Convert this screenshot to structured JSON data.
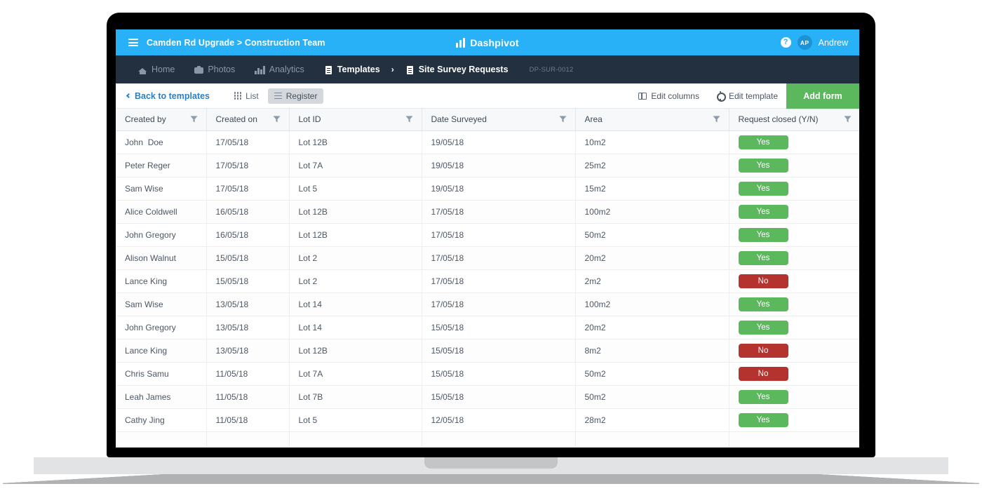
{
  "topbar": {
    "menu_icon": "hamburger-icon",
    "breadcrumb": "Camden Rd Upgrade > Construction Team",
    "brand": "Dashpivot",
    "brand_icon": "bar-chart-icon",
    "help_icon": "help-circle-icon",
    "help_glyph": "?",
    "avatar_initials": "AP",
    "user_name": "Andrew",
    "bg_color": "#29b1f7"
  },
  "nav": {
    "items": [
      {
        "label": "Home",
        "icon": "home-icon",
        "active": false
      },
      {
        "label": "Photos",
        "icon": "camera-icon",
        "active": false
      },
      {
        "label": "Analytics",
        "icon": "analytics-icon",
        "active": false
      },
      {
        "label": "Templates",
        "icon": "document-icon",
        "active": true
      },
      {
        "label": "Site Survey Requests",
        "icon": "document-icon",
        "active": true
      }
    ],
    "separator": "›",
    "code": "DP-SUR-0012",
    "bg_color": "#22303f"
  },
  "toolbar": {
    "back_label": "Back to templates",
    "back_icon": "chevron-left-icon",
    "view_tabs": [
      {
        "label": "List",
        "icon": "grid-icon",
        "active": false
      },
      {
        "label": "Register",
        "icon": "lines-icon",
        "active": true
      }
    ],
    "edit_columns_label": "Edit columns",
    "edit_columns_icon": "columns-icon",
    "edit_template_label": "Edit template",
    "edit_template_icon": "gear-icon",
    "add_form_label": "Add form",
    "add_form_color": "#5cb85c"
  },
  "table": {
    "columns": [
      {
        "label": "Created by",
        "filter_icon": "filter-icon"
      },
      {
        "label": "Created on",
        "filter_icon": "filter-icon"
      },
      {
        "label": "Lot ID",
        "filter_icon": "filter-icon"
      },
      {
        "label": "Date Surveyed",
        "filter_icon": "filter-icon"
      },
      {
        "label": "Area",
        "filter_icon": "filter-icon"
      },
      {
        "label": "Request closed (Y/N)",
        "filter_icon": "filter-icon"
      }
    ],
    "rows": [
      {
        "created_by": "John  Doe",
        "created_on": "17/05/18",
        "lot_id": "Lot 12B",
        "date_surveyed": "19/05/18",
        "area": "10m2",
        "closed": "Yes"
      },
      {
        "created_by": "Peter Reger",
        "created_on": "17/05/18",
        "lot_id": "Lot 7A",
        "date_surveyed": "19/05/18",
        "area": "25m2",
        "closed": "Yes"
      },
      {
        "created_by": "Sam Wise",
        "created_on": "17/05/18",
        "lot_id": "Lot 5",
        "date_surveyed": "19/05/18",
        "area": "15m2",
        "closed": "Yes"
      },
      {
        "created_by": "Alice Coldwell",
        "created_on": "16/05/18",
        "lot_id": "Lot 12B",
        "date_surveyed": "17/05/18",
        "area": "100m2",
        "closed": "Yes"
      },
      {
        "created_by": "John Gregory",
        "created_on": "16/05/18",
        "lot_id": "Lot 12B",
        "date_surveyed": "17/05/18",
        "area": "50m2",
        "closed": "Yes"
      },
      {
        "created_by": "Alison Walnut",
        "created_on": "15/05/18",
        "lot_id": "Lot 2",
        "date_surveyed": "17/05/18",
        "area": "20m2",
        "closed": "Yes"
      },
      {
        "created_by": "Lance King",
        "created_on": "15/05/18",
        "lot_id": "Lot 2",
        "date_surveyed": "17/05/18",
        "area": "2m2",
        "closed": "No"
      },
      {
        "created_by": "Sam Wise",
        "created_on": "13/05/18",
        "lot_id": "Lot 14",
        "date_surveyed": "17/05/18",
        "area": "100m2",
        "closed": "Yes"
      },
      {
        "created_by": "John Gregory",
        "created_on": "13/05/18",
        "lot_id": "Lot 14",
        "date_surveyed": "15/05/18",
        "area": "20m2",
        "closed": "Yes"
      },
      {
        "created_by": "Lance King",
        "created_on": "13/05/18",
        "lot_id": "Lot 12B",
        "date_surveyed": "15/05/18",
        "area": "8m2",
        "closed": "No"
      },
      {
        "created_by": "Chris Samu",
        "created_on": "11/05/18",
        "lot_id": "Lot 7A",
        "date_surveyed": "15/05/18",
        "area": "50m2",
        "closed": "No"
      },
      {
        "created_by": "Leah James",
        "created_on": "11/05/18",
        "lot_id": "Lot 7B",
        "date_surveyed": "15/05/18",
        "area": "50m2",
        "closed": "Yes"
      },
      {
        "created_by": "Cathy Jing",
        "created_on": "11/05/18",
        "lot_id": "Lot 5",
        "date_surveyed": "12/05/18",
        "area": "28m2",
        "closed": "Yes"
      },
      {
        "created_by": "",
        "created_on": "",
        "lot_id": "",
        "date_surveyed": "",
        "area": "",
        "closed": ""
      }
    ],
    "badge_colors": {
      "Yes": "#5cb85c",
      "No": "#b5332f"
    }
  }
}
